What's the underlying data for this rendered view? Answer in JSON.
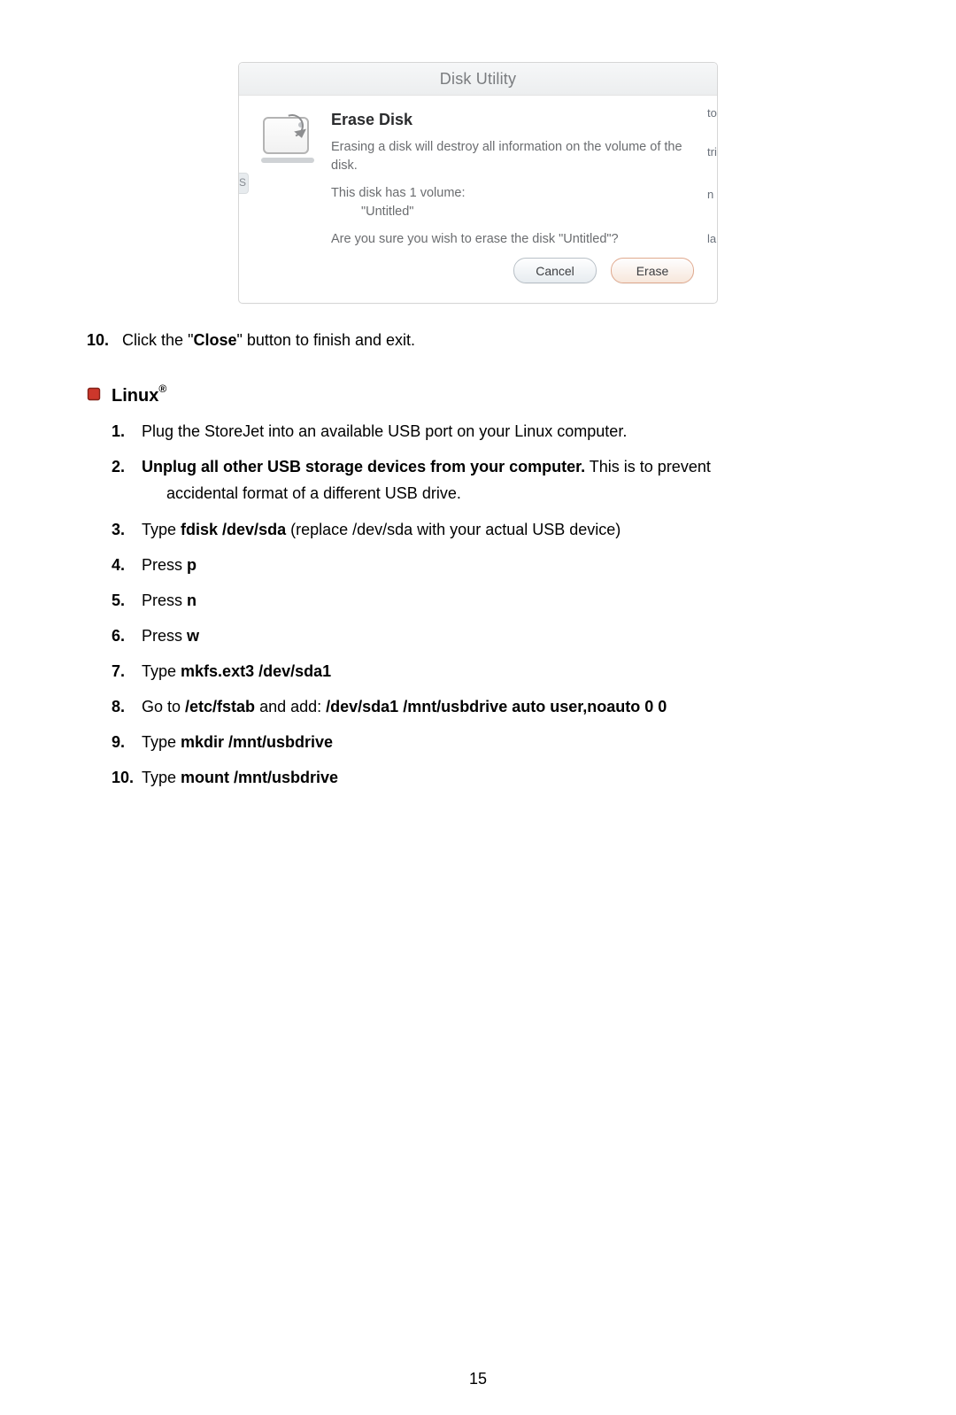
{
  "dialog": {
    "titlebar": "Disk Utility",
    "heading": "Erase Disk",
    "msg1": "Erasing a disk will destroy all information on the volume of the disk.",
    "msg2_line1": "This disk has 1 volume:",
    "msg2_line2": "\"Untitled\"",
    "msg3": "Are you sure you wish to erase the disk \"Untitled\"?",
    "buttons": {
      "cancel": "Cancel",
      "erase": "Erase"
    },
    "peek": {
      "p1": "to",
      "p2": "tri",
      "p3": "n",
      "p4": "la"
    },
    "left_tab": "S"
  },
  "after_dialog_step": {
    "num": "10.",
    "text_pre": "Click the \"",
    "bold": "Close",
    "text_post": "\" button to finish and exit."
  },
  "section_linux": {
    "title": "Linux",
    "reg": "®",
    "items": [
      {
        "n": "1.",
        "type": "plain",
        "text": "Plug the StoreJet   into an available USB port on your Linux computer."
      },
      {
        "n": "2.",
        "type": "bold_lead_wrap",
        "bold": "Unplug all other USB storage devices from your computer.",
        "rest": " This is to prevent",
        "wrap": "accidental format of a different USB drive."
      },
      {
        "n": "3.",
        "type": "mixed",
        "pre": "Type ",
        "bold": "fdisk /dev/sda",
        "post": " (replace /dev/sda with your actual USB device)"
      },
      {
        "n": "4.",
        "type": "mixed",
        "pre": "Press ",
        "bold": "p",
        "post": ""
      },
      {
        "n": "5.",
        "type": "mixed",
        "pre": "Press ",
        "bold": "n",
        "post": ""
      },
      {
        "n": "6.",
        "type": "mixed",
        "pre": "Press ",
        "bold": "w",
        "post": ""
      },
      {
        "n": "7.",
        "type": "mixed",
        "pre": "Type ",
        "bold": "mkfs.ext3 /dev/sda1",
        "post": ""
      },
      {
        "n": "8.",
        "type": "mixed2",
        "pre": "Go to ",
        "bold1": "/etc/fstab",
        "mid": " and add: ",
        "bold2": "/dev/sda1 /mnt/usbdrive auto user,noauto 0 0"
      },
      {
        "n": "9.",
        "type": "mixed",
        "pre": "Type ",
        "bold": "mkdir /mnt/usbdrive",
        "post": ""
      },
      {
        "n": "10.",
        "type": "mixed",
        "pre": "Type ",
        "bold": "mount /mnt/usbdrive",
        "post": ""
      }
    ]
  },
  "page_number": "15",
  "colors": {
    "bullet_fill": "#cc372b",
    "bullet_stroke": "#832219"
  }
}
